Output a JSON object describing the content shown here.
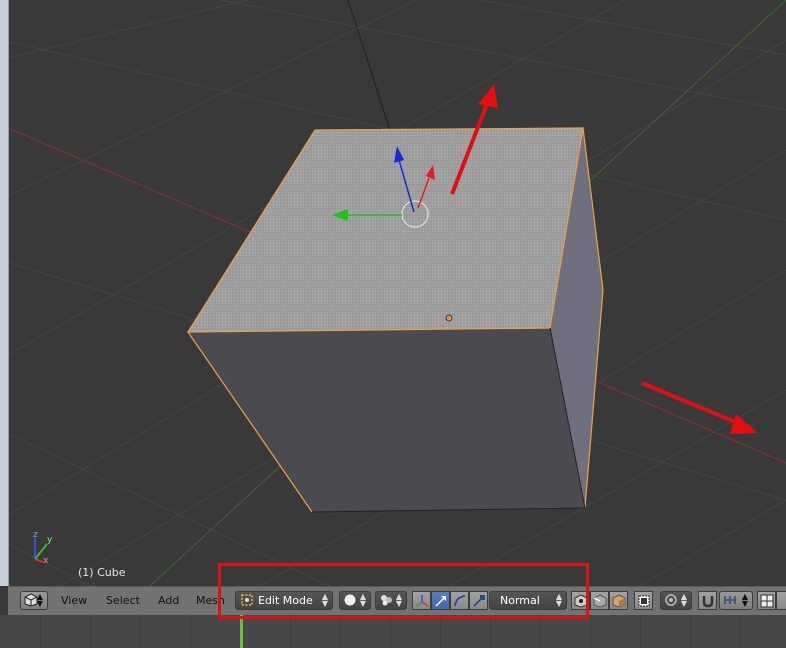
{
  "viewport": {
    "object_label": "(1) Cube",
    "axis_labels": {
      "x": "x",
      "y": "y",
      "z": "z"
    }
  },
  "header": {
    "editor_type_icon": "cube-icon",
    "menus": [
      "View",
      "Select",
      "Add",
      "Mesh"
    ],
    "mode": {
      "icon": "edit-mode-icon",
      "label": "Edit Mode"
    },
    "viewport_shading_icon": "solid-sphere-icon",
    "pivot_icon": "pivot-point-icon",
    "manipulator": {
      "toggle_icon": "axes-icon",
      "translate_icon": "translate-arrow-icon",
      "rotate_icon": "rotate-arc-icon",
      "scale_icon": "scale-icon",
      "orientation": "Normal"
    },
    "select_mode_icons": [
      "vertex-select-icon",
      "edge-select-icon",
      "face-select-icon"
    ],
    "limit_selection_icon": "occlude-geometry-icon",
    "proportional_icon": "proportional-edit-icon",
    "snap_icon": "magnet-icon",
    "snap_element_icon": "snap-increment-icon",
    "render_icon": "render-grid-icon"
  },
  "colors": {
    "highlight": "#e01010",
    "selection_edge": "#f0a040",
    "header_bg": "#727272",
    "viewport_bg": "#393939",
    "active_button": "#4a72b4"
  }
}
